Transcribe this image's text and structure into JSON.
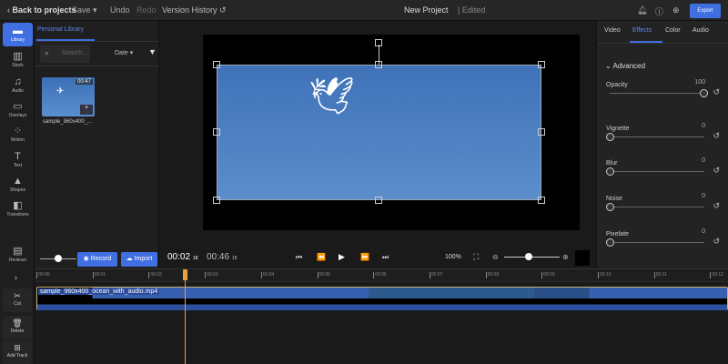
{
  "topbar": {
    "back": "Back to projects",
    "save": "Save",
    "undo": "Undo",
    "redo": "Redo",
    "version_history": "Version History",
    "project_name": "New Project",
    "status": "| Edited",
    "export": "Export"
  },
  "rail": [
    {
      "label": "Library",
      "icon": "folder-icon"
    },
    {
      "label": "Stock",
      "icon": "stock-icon"
    },
    {
      "label": "Audio",
      "icon": "music-icon"
    },
    {
      "label": "Overlays",
      "icon": "overlays-icon"
    },
    {
      "label": "Motion",
      "icon": "motion-icon"
    },
    {
      "label": "Text",
      "icon": "text-icon"
    },
    {
      "label": "Shapes",
      "icon": "shapes-icon"
    },
    {
      "label": "Transitions",
      "icon": "transitions-icon"
    },
    {
      "label": "Reviews",
      "icon": "reviews-icon"
    }
  ],
  "library": {
    "tab": "Personal Library",
    "search_placeholder": "Search...",
    "sort": "Date",
    "item": {
      "name": "sample_960x400_...",
      "duration": "00:47"
    },
    "record": "Record",
    "import": "Import"
  },
  "player": {
    "current": "00:02",
    "current_frame": "18",
    "total": "00:46",
    "total_frame": "18",
    "zoom": "100%",
    "timeline_zoom_pct": 50,
    "size_slider_pct": 50
  },
  "right": {
    "tabs": [
      "Video",
      "Effects",
      "Color",
      "Audio"
    ],
    "active_tab": "Effects",
    "section": "Advanced",
    "sliders": [
      {
        "label": "Opacity",
        "value": "100",
        "pct": 100
      },
      {
        "label": "Vignette",
        "value": "0",
        "pct": 0
      },
      {
        "label": "Blur",
        "value": "0",
        "pct": 0
      },
      {
        "label": "Noise",
        "value": "0",
        "pct": 0
      },
      {
        "label": "Pixelate",
        "value": "0",
        "pct": 0
      }
    ]
  },
  "tools": {
    "cut": "Cut",
    "delete": "Delete",
    "add_track": "Add Track"
  },
  "timeline": {
    "ticks": [
      "00:00",
      "00:01",
      "00:02",
      "00:03",
      "00:04",
      "00:05",
      "00:06",
      "00:07",
      "00:08",
      "00:09",
      "00:10",
      "00:11",
      "00:12"
    ],
    "clip": "sample_960x400_ocean_with_audio.mp4"
  },
  "colors": {
    "accent": "#3f6fe0",
    "playhead": "#e8a33a"
  }
}
